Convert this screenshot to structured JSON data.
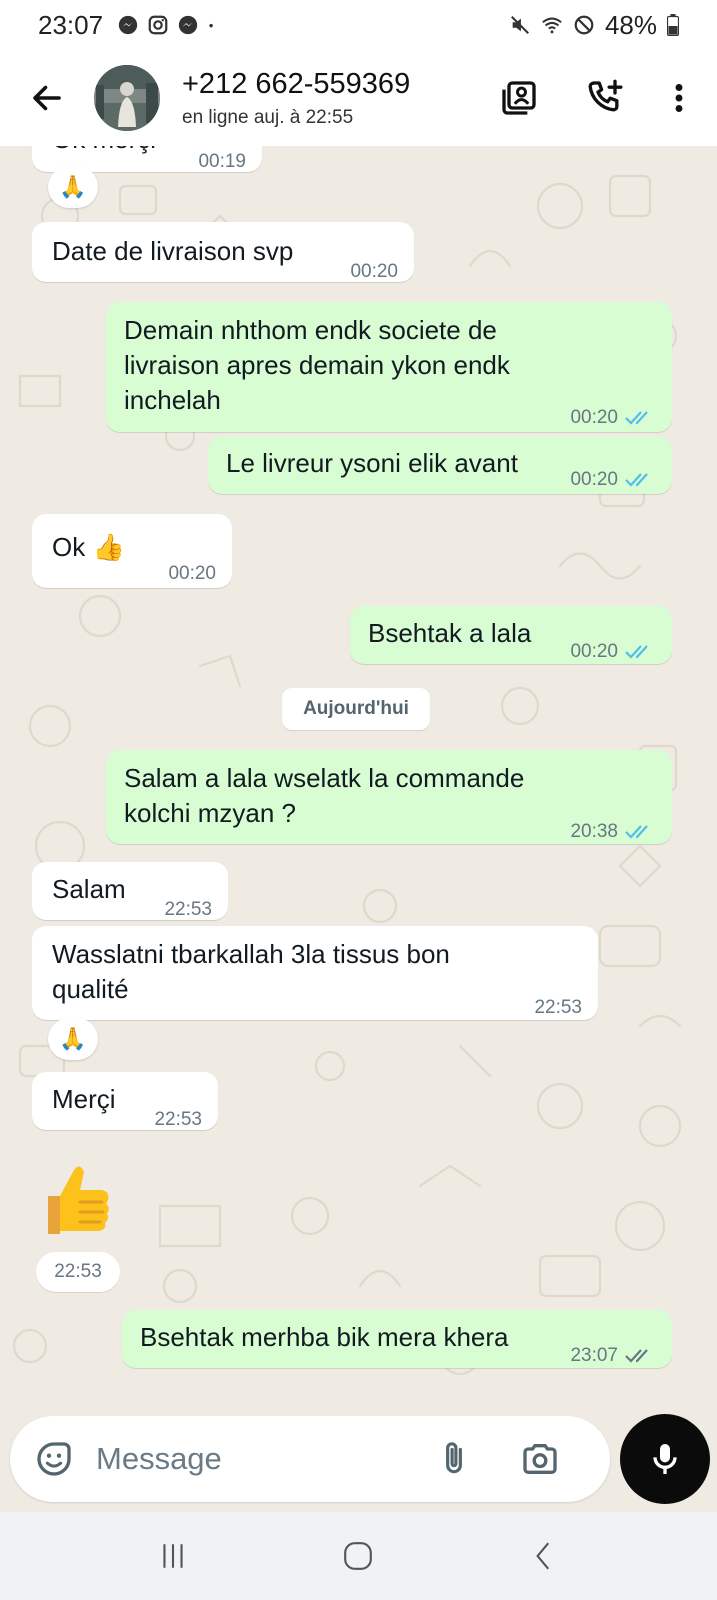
{
  "status_bar": {
    "time": "23:07",
    "battery": "48%",
    "icons": [
      "messenger-icon",
      "instagram-icon",
      "messenger-icon",
      "dot-icon",
      "mute-icon",
      "wifi-icon",
      "dnd-icon",
      "battery-icon"
    ]
  },
  "header": {
    "contact_name": "+212 662-559369",
    "status": "en ligne auj. à 22:55",
    "icons": [
      "back-arrow-icon",
      "contact-card-icon",
      "add-call-icon",
      "more-vert-icon"
    ]
  },
  "messages": [
    {
      "id": "m0",
      "dir": "in",
      "text": "Ok merçi",
      "time": "00:19"
    },
    {
      "id": "m1",
      "dir": "in",
      "text": "Date de livraison svp",
      "time": "00:20"
    },
    {
      "id": "m2",
      "dir": "out",
      "text": "Demain nhthom endk societe de\nlivraison apres demain ykon endk\ninchelah",
      "time": "00:20"
    },
    {
      "id": "m3",
      "dir": "out",
      "text": "Le livreur ysoni elik avant",
      "time": "00:20"
    },
    {
      "id": "m4",
      "dir": "in",
      "text": "Ok 👍",
      "time": "00:20"
    },
    {
      "id": "m5",
      "dir": "out",
      "text": "Bsehtak a lala",
      "time": "00:20"
    },
    {
      "id": "m6",
      "dir": "out",
      "text": "Salam a lala wselatk la commande\nkolchi mzyan ?",
      "time": "20:38"
    },
    {
      "id": "m7",
      "dir": "in",
      "text": "Salam",
      "time": "22:53"
    },
    {
      "id": "m8",
      "dir": "in",
      "text": "Wasslatni tbarkallah 3la tissus bon\nqualité",
      "time": "22:53"
    },
    {
      "id": "m9",
      "dir": "in",
      "text": "Merçi",
      "time": "22:53"
    },
    {
      "id": "m10",
      "dir": "out",
      "text": "Bsehtak merhba bik mera khera",
      "time": "23:07"
    }
  ],
  "reactions": [
    "🙏",
    "🙏"
  ],
  "date_separator": "Aujourd'hui",
  "sticker": {
    "emoji": "👍",
    "time": "22:53"
  },
  "composer": {
    "placeholder": "Message"
  },
  "colors": {
    "incoming": "#ffffff",
    "outgoing": "#d9fdd3",
    "read_ticks": "#53bdeb",
    "sent_ticks": "#667781",
    "background": "#efeae2"
  }
}
